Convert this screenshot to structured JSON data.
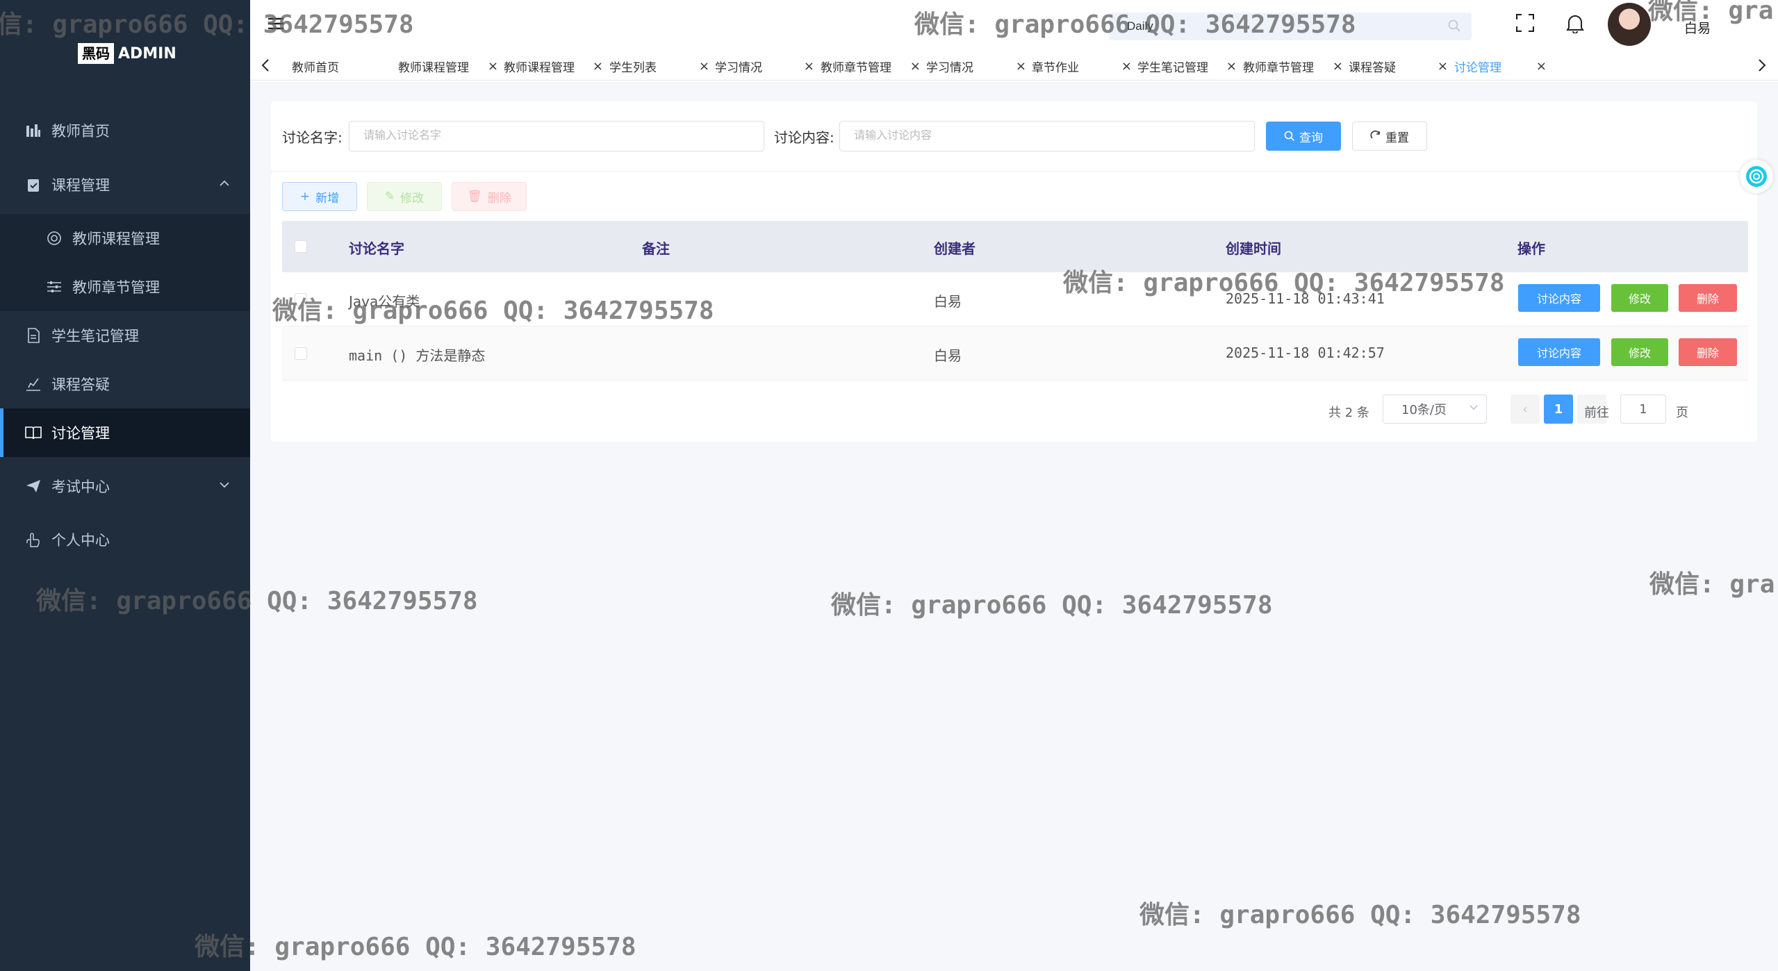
{
  "logo": {
    "box": "黑码",
    "text": "ADMIN"
  },
  "sidebar": {
    "items": [
      {
        "label": "教师首页",
        "icon": "chart-icon"
      },
      {
        "label": "课程管理",
        "icon": "clipboard-icon",
        "expanded": true,
        "children": [
          {
            "label": "教师课程管理",
            "icon": "cog-circle-icon"
          },
          {
            "label": "教师章节管理",
            "icon": "sliders-icon"
          }
        ]
      },
      {
        "label": "学生笔记管理",
        "icon": "document-icon"
      },
      {
        "label": "课程答疑",
        "icon": "pen-icon"
      },
      {
        "label": "讨论管理",
        "icon": "book-icon",
        "active": true
      },
      {
        "label": "考试中心",
        "icon": "send-icon"
      },
      {
        "label": "个人中心",
        "icon": "hand-icon"
      }
    ]
  },
  "header": {
    "search_value": "Daily",
    "username": "白易"
  },
  "tabs": [
    {
      "label": "教师首页"
    },
    {
      "label": "教师课程管理"
    },
    {
      "label": "教师课程管理"
    },
    {
      "label": "学生列表"
    },
    {
      "label": "学习情况"
    },
    {
      "label": "教师章节管理"
    },
    {
      "label": "学习情况"
    },
    {
      "label": "章节作业"
    },
    {
      "label": "学生笔记管理"
    },
    {
      "label": "教师章节管理"
    },
    {
      "label": "课程答疑"
    },
    {
      "label": "讨论管理",
      "active": true
    }
  ],
  "search_form": {
    "name_label": "讨论名字:",
    "name_placeholder": "请输入讨论名字",
    "content_label": "讨论内容:",
    "content_placeholder": "请输入讨论内容",
    "query_label": "查询",
    "reset_label": "重置"
  },
  "toolbar": {
    "add_label": "新增",
    "edit_label": "修改",
    "delete_label": "删除"
  },
  "table": {
    "columns": [
      "讨论名字",
      "备注",
      "创建者",
      "创建时间",
      "操作"
    ],
    "rows": [
      {
        "name": "Java公有类",
        "remark": "",
        "creator": "白易",
        "created": "2025-11-18 01:43:41"
      },
      {
        "name": "main () 方法是静态",
        "remark": "",
        "creator": "白易",
        "created": "2025-11-18 01:42:57"
      }
    ],
    "row_actions": {
      "view": "讨论内容",
      "edit": "修改",
      "delete": "删除"
    }
  },
  "pagination": {
    "total_text": "共 2 条",
    "page_size": "10条/页",
    "current_page": "1",
    "goto_label": "前往",
    "goto_value": "1",
    "page_suffix": "页"
  },
  "watermarks": {
    "w1": "信: grapro666 QQ: 3642795578",
    "w2": "微信: grapro666 QQ: 3642795578",
    "w3": "微信: gra",
    "w4": "微信: grapro666 QQ: 3642795578",
    "w5": "微信: grapro666 QQ: 3642795578",
    "w6": "微信: grapro666 QQ: 3642795578",
    "w7": "微信: grapro666 QQ: 3642795578",
    "w8": "微信: gra",
    "w9": "微信: grapro666 QQ: 3642795578",
    "w10": "微信: grapro666 QQ: 3642795578"
  },
  "colors": {
    "sidebar_bg": "#1f2d3d",
    "primary": "#409eff",
    "success": "#67c23a",
    "danger": "#f56c6c"
  }
}
